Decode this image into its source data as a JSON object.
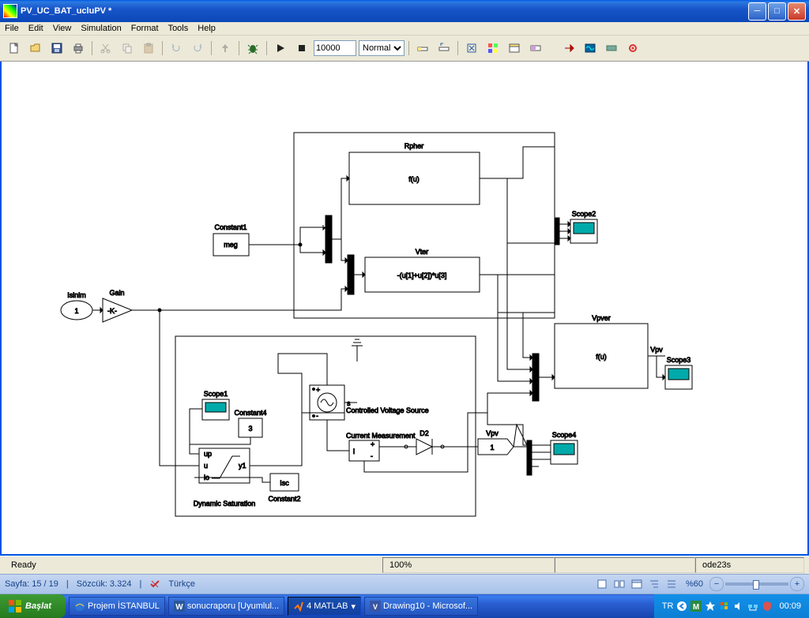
{
  "window": {
    "title": "PV_UC_BAT_ucluPV *"
  },
  "menu": {
    "file": "File",
    "edit": "Edit",
    "view": "View",
    "simulation": "Simulation",
    "format": "Format",
    "tools": "Tools",
    "help": "Help"
  },
  "toolbar": {
    "time": "10000",
    "mode": "Normal"
  },
  "blocks": {
    "rpher_lbl": "Rpher",
    "rpher_fn": "f(u)",
    "constant1": "Constant1",
    "constant1_val": "meg",
    "scope2": "Scope2",
    "vter_lbl": "Vter",
    "vter_fn": "-(u[1]+u[2])*u[3]",
    "gain": "Gain",
    "gain_val": "-K-",
    "isinim": "Isinim",
    "isinim_val": "1",
    "vpver_lbl": "Vpver",
    "vpver_fn": "f(u)",
    "vpv": "Vpv",
    "scope3": "Scope3",
    "cvs": "Controlled Voltage Source",
    "cm": "Current Measurement",
    "d2": "D2",
    "vpv2": "Vpv",
    "vpv2_val": "1",
    "scope4": "Scope4",
    "scope1": "Scope1",
    "constant4": "Constant4",
    "constant4_val": "3",
    "dynsat": "Dynamic\nSaturation",
    "dyn_up": "up",
    "dyn_u": "u",
    "dyn_lo": "lo",
    "dyn_y": "y1",
    "constant2": "Constant2",
    "constant2_val": "Isc"
  },
  "status": {
    "ready": "Ready",
    "zoom": "100%",
    "solver": "ode23s"
  },
  "wordbar": {
    "page": "Sayfa: 15 / 19",
    "words": "Sözcük: 3.324",
    "lang": "Türkçe",
    "wordzoom": "%60"
  },
  "taskbar": {
    "start": "Başlat",
    "b1": "Projem İSTANBUL",
    "b2": "sonucraporu [Uyumlul...",
    "b3": "4 MATLAB",
    "b4": "Drawing10 - Microsof...",
    "langind": "TR",
    "clock": "00:09"
  }
}
